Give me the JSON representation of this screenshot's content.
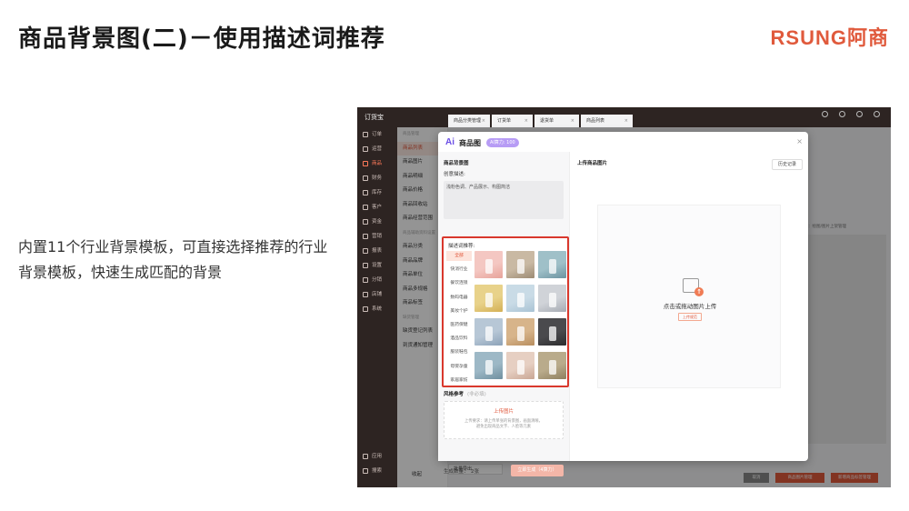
{
  "slide": {
    "title": "商品背景图(二)－使用描述词推荐",
    "logo": "RSUNG阿商",
    "description": "内置11个行业背景模板，可直接选择推荐的行业背景模板，快速生成匹配的背景"
  },
  "app": {
    "brand": "订货宝",
    "nav": [
      {
        "label": "订单",
        "active": false
      },
      {
        "label": "运营",
        "active": false
      },
      {
        "label": "商品",
        "active": true
      },
      {
        "label": "财务",
        "active": false
      },
      {
        "label": "库存",
        "active": false
      },
      {
        "label": "客户",
        "active": false
      },
      {
        "label": "资金",
        "active": false
      },
      {
        "label": "营销",
        "active": false
      },
      {
        "label": "报表",
        "active": false
      },
      {
        "label": "设置",
        "active": false
      },
      {
        "label": "分销",
        "active": false
      },
      {
        "label": "店铺",
        "active": false
      },
      {
        "label": "系统",
        "active": false
      }
    ],
    "nav_bottom": [
      {
        "label": "应用"
      },
      {
        "label": "搜索"
      }
    ],
    "subnav_header": "商品管理",
    "subnav": [
      {
        "label": "商品列表",
        "active": true,
        "grey": false
      },
      {
        "label": "商品图片",
        "active": false,
        "grey": false
      },
      {
        "label": "商品明细",
        "active": false,
        "grey": false
      },
      {
        "label": "商品价格",
        "active": false,
        "grey": false
      },
      {
        "label": "商品回收站",
        "active": false,
        "grey": false
      },
      {
        "label": "商品经营范围",
        "active": false,
        "grey": false
      },
      {
        "label": "商品辅助资料设置",
        "active": false,
        "grey": true
      },
      {
        "label": "商品分类",
        "active": false,
        "grey": false
      },
      {
        "label": "商品品牌",
        "active": false,
        "grey": false
      },
      {
        "label": "商品单位",
        "active": false,
        "grey": false
      },
      {
        "label": "商品多规格",
        "active": false,
        "grey": false
      },
      {
        "label": "商品标签",
        "active": false,
        "grey": false
      },
      {
        "label": "缺货管理",
        "active": false,
        "grey": true
      },
      {
        "label": "缺货登记列表",
        "active": false,
        "grey": false
      },
      {
        "label": "到货通知管理",
        "active": false,
        "grey": false
      }
    ],
    "subnav_collapse": "收起",
    "tabs": [
      "商品分类管理",
      "订货单",
      "退货单",
      "商品列表"
    ],
    "bg_hint": "图片：绘图/图片上架管理",
    "bg_select": "批量导出",
    "bg_buttons": [
      {
        "label": "取消",
        "color": "#888888"
      },
      {
        "label": "商品图片管理",
        "color": "#e05a3c"
      },
      {
        "label": "新增商品标签管理",
        "color": "#e05a3c"
      }
    ]
  },
  "modal": {
    "ai_mark": "Ai",
    "title": "商品图",
    "badge": "AI算力: 100",
    "close": "×",
    "section_title": "商品背景图",
    "desc_label": "创意描述:",
    "desc_value": "浅粉色调、产品展示、构图简洁",
    "keywords_label": "描述词推荐:",
    "categories": [
      {
        "label": "全部",
        "active": true
      },
      {
        "label": "快消行业",
        "active": false
      },
      {
        "label": "餐饮连锁",
        "active": false
      },
      {
        "label": "数码电器",
        "active": false
      },
      {
        "label": "美妆个护",
        "active": false
      },
      {
        "label": "医药保健",
        "active": false
      },
      {
        "label": "酒品饮料",
        "active": false
      },
      {
        "label": "服装鞋包",
        "active": false
      },
      {
        "label": "母婴孕童",
        "active": false
      },
      {
        "label": "家居家纺",
        "active": false
      }
    ],
    "thumbs": [
      {
        "color": "#f4c7c2",
        "accent": "#e7a39a"
      },
      {
        "color": "#c9b9a3",
        "accent": "#9c8b74"
      },
      {
        "color": "#9fc0c8",
        "accent": "#6c93a0"
      },
      {
        "color": "#e8d28a",
        "accent": "#d4b055"
      },
      {
        "color": "#c9dbe6",
        "accent": "#a9c3d4"
      },
      {
        "color": "#d0d3d8",
        "accent": "#a6abb3"
      },
      {
        "color": "#b7c7d6",
        "accent": "#8ca2b8"
      },
      {
        "color": "#d7b48a",
        "accent": "#b88e5f"
      },
      {
        "color": "#4a4a4d",
        "accent": "#2c2c2e"
      },
      {
        "color": "#9db8c6",
        "accent": "#6f8f9f"
      },
      {
        "color": "#e6cfc2",
        "accent": "#c9a694"
      },
      {
        "color": "#b9ab8b",
        "accent": "#8e7f5f"
      }
    ],
    "style_label": "风格参考",
    "style_optional": "(非必填)",
    "style_upload": "上传图片",
    "style_hint1": "上传要求：请上传单张的背景图，画面清晰，",
    "style_hint2": "避免出现商品文字、人脸等元素",
    "count_label": "生成数量：",
    "count_value": "2张",
    "generate_label": "立即生成（4算力）",
    "upload_title": "上传商品图片",
    "history_label": "历史记录",
    "drop_text": "点击或拖动图片上传",
    "drop_tag": "上传规范"
  }
}
